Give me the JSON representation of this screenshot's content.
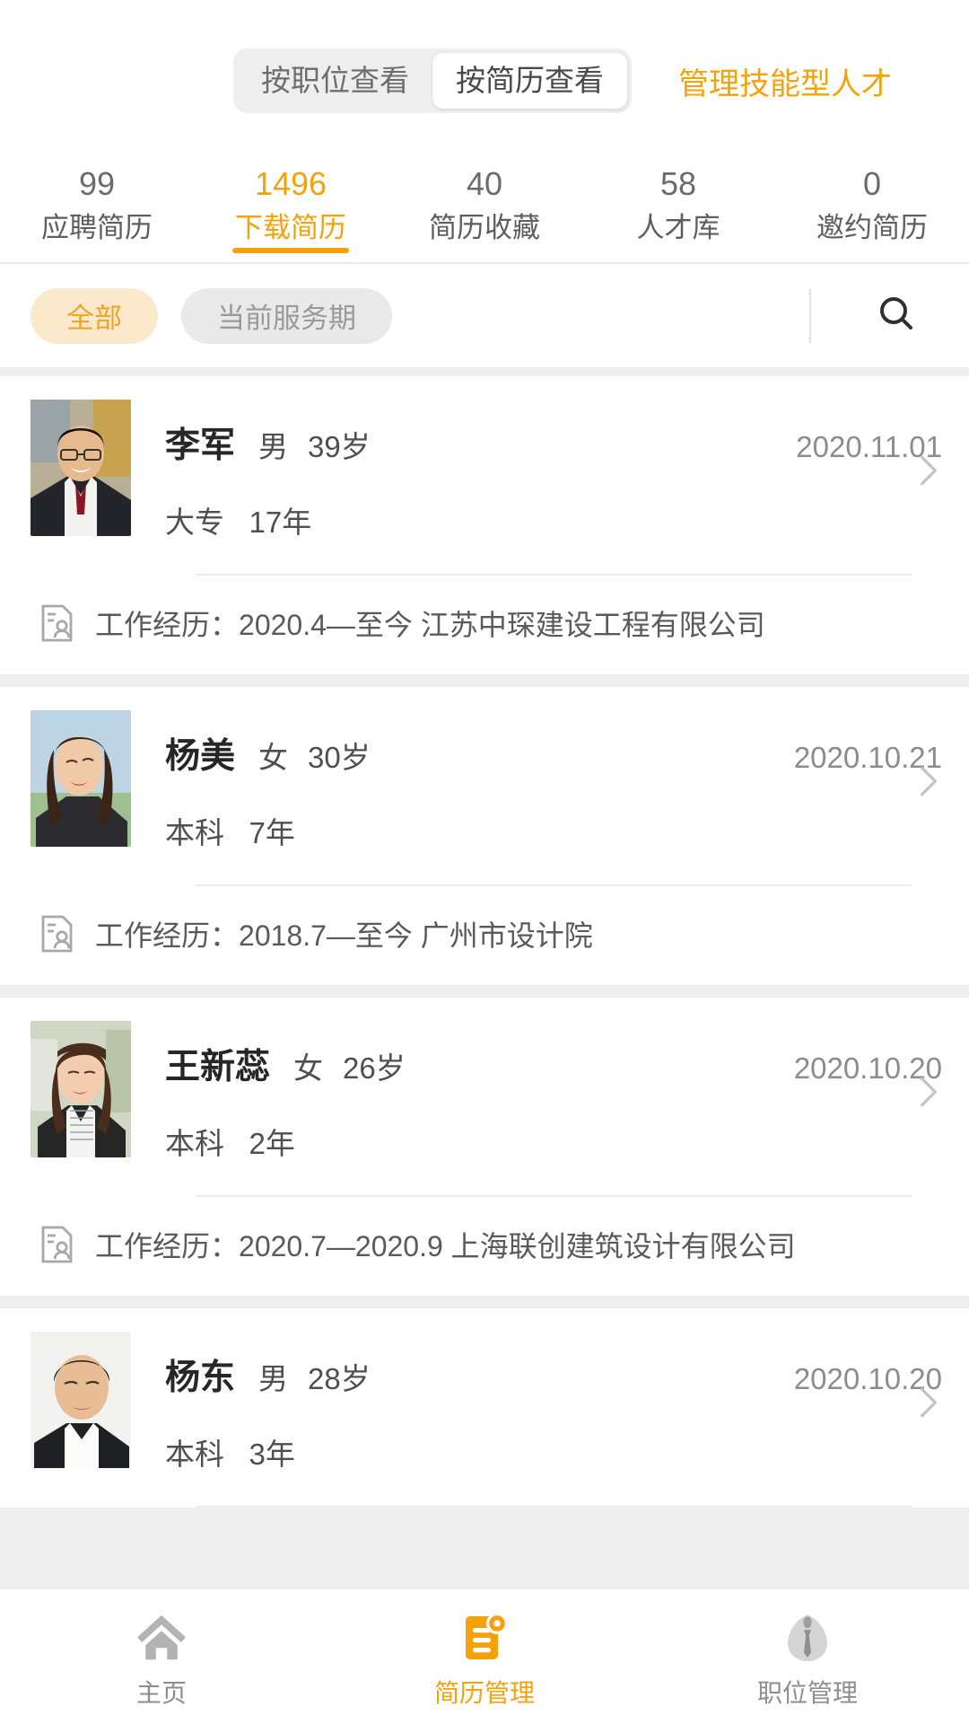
{
  "header": {
    "segmented": [
      {
        "label": "按职位查看",
        "active": false
      },
      {
        "label": "按简历查看",
        "active": true
      }
    ],
    "action_label": "管理技能型人才",
    "accent_color": "#f5a20a"
  },
  "stats": [
    {
      "value": "99",
      "label": "应聘简历",
      "active": false
    },
    {
      "value": "1496",
      "label": "下载简历",
      "active": true
    },
    {
      "value": "40",
      "label": "简历收藏",
      "active": false
    },
    {
      "value": "58",
      "label": "人才库",
      "active": false
    },
    {
      "value": "0",
      "label": "邀约简历",
      "active": false
    }
  ],
  "filters": {
    "chips": [
      {
        "label": "全部",
        "active": true
      },
      {
        "label": "当前服务期",
        "active": false
      }
    ],
    "search_icon": "search-icon"
  },
  "resumes": [
    {
      "name": "李军",
      "gender": "男",
      "age": "39岁",
      "education": "大专",
      "experience_years": "17年",
      "date": "2020.11.01",
      "work_label": "工作经历：",
      "work_detail": "2020.4—至今  江苏中琛建设工程有限公司",
      "avatar": "male-1"
    },
    {
      "name": "杨美",
      "gender": "女",
      "age": "30岁",
      "education": "本科",
      "experience_years": "7年",
      "date": "2020.10.21",
      "work_label": "工作经历：",
      "work_detail": "2018.7—至今  广州市设计院",
      "avatar": "female-1"
    },
    {
      "name": "王新蕊",
      "gender": "女",
      "age": "26岁",
      "education": "本科",
      "experience_years": "2年",
      "date": "2020.10.20",
      "work_label": "工作经历：",
      "work_detail": "2020.7—2020.9  上海联创建筑设计有限公司",
      "avatar": "female-2"
    },
    {
      "name": "杨东",
      "gender": "男",
      "age": "28岁",
      "education": "本科",
      "experience_years": "3年",
      "date": "2020.10.20",
      "work_label": "",
      "work_detail": "",
      "avatar": "male-2"
    }
  ],
  "tabbar": [
    {
      "label": "主页",
      "icon": "home-icon",
      "active": false
    },
    {
      "label": "简历管理",
      "icon": "resume-icon",
      "active": true
    },
    {
      "label": "职位管理",
      "icon": "tie-icon",
      "active": false
    }
  ]
}
